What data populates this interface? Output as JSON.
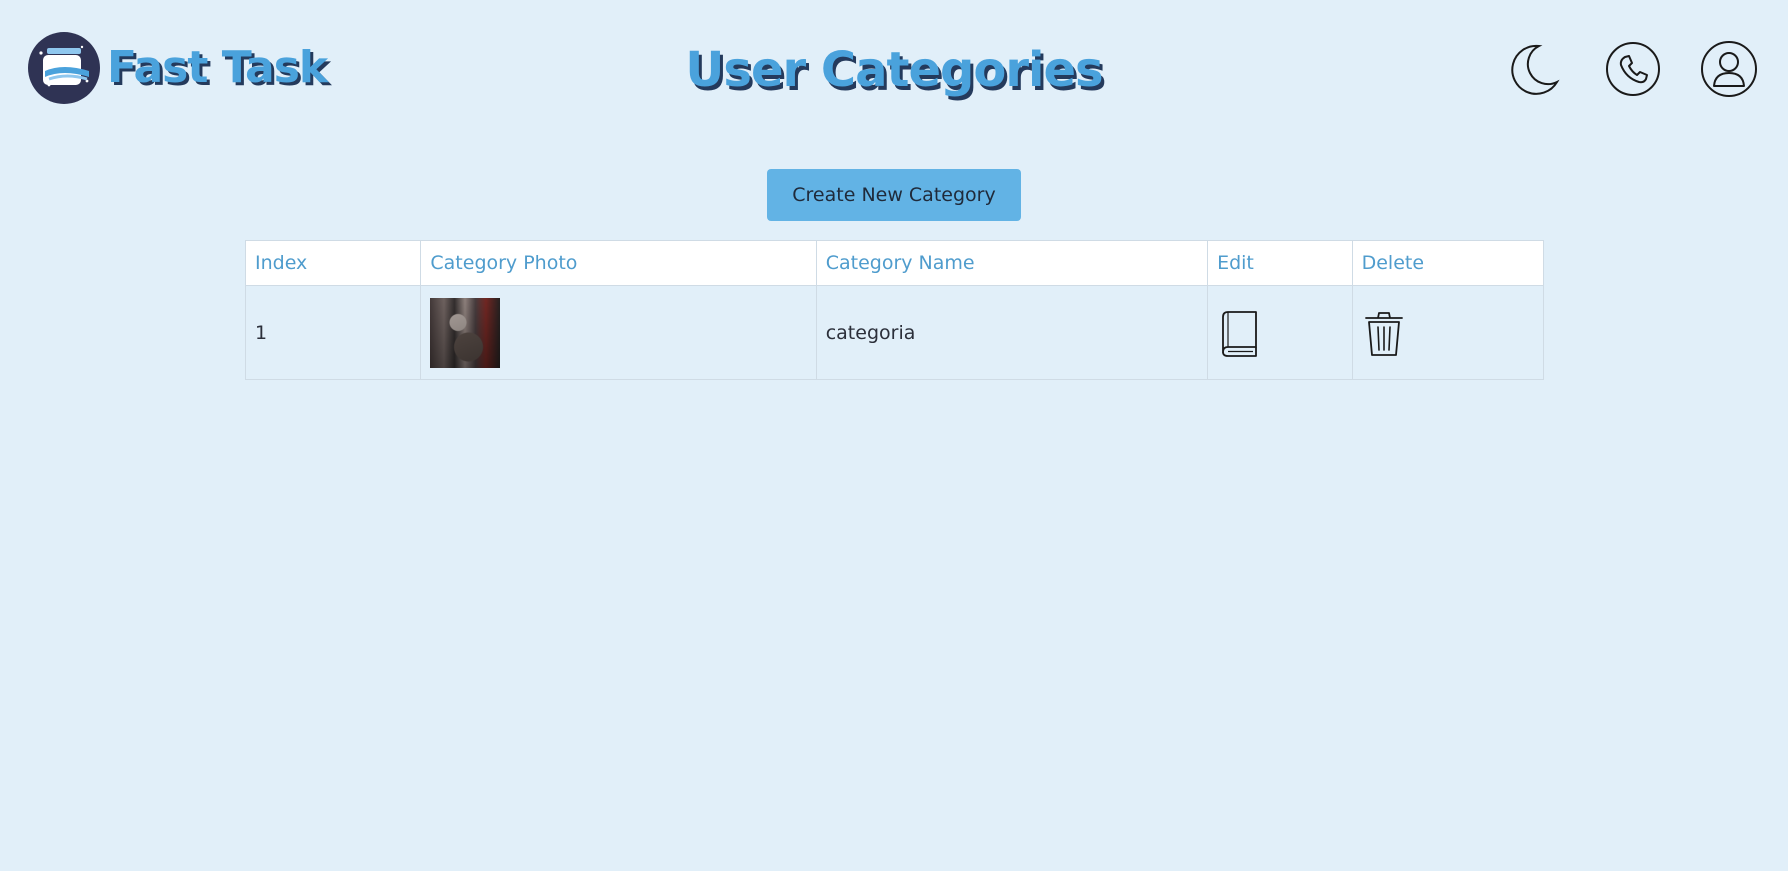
{
  "header": {
    "brand_name": "Fast Task",
    "title": "User Categories",
    "icons": {
      "theme_toggle": "moon-icon",
      "contact": "phone-icon",
      "profile": "user-icon"
    }
  },
  "actions": {
    "create_label": "Create New Category"
  },
  "table": {
    "columns": [
      "Index",
      "Category Photo",
      "Category Name",
      "Edit",
      "Delete"
    ],
    "rows": [
      {
        "index": "1",
        "photo_icon": "category-photo",
        "name": "categoria",
        "edit_icon": "book-icon",
        "delete_icon": "trash-icon"
      }
    ]
  },
  "colors": {
    "background": "#e1eff9",
    "accent": "#4aa2dc",
    "button": "#62b3e5",
    "header_text": "#4f9ccd",
    "title_shadow": "#243a5c"
  }
}
